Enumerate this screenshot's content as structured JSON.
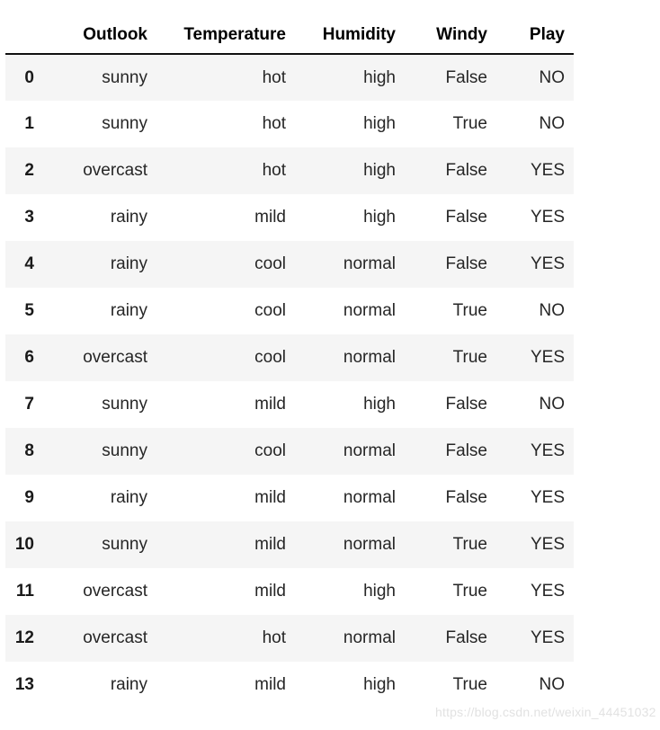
{
  "table": {
    "index_header": "",
    "columns": [
      "Outlook",
      "Temperature",
      "Humidity",
      "Windy",
      "Play"
    ],
    "rows": [
      {
        "index": "0",
        "cells": [
          "sunny",
          "hot",
          "high",
          "False",
          "NO"
        ]
      },
      {
        "index": "1",
        "cells": [
          "sunny",
          "hot",
          "high",
          "True",
          "NO"
        ]
      },
      {
        "index": "2",
        "cells": [
          "overcast",
          "hot",
          "high",
          "False",
          "YES"
        ]
      },
      {
        "index": "3",
        "cells": [
          "rainy",
          "mild",
          "high",
          "False",
          "YES"
        ]
      },
      {
        "index": "4",
        "cells": [
          "rainy",
          "cool",
          "normal",
          "False",
          "YES"
        ]
      },
      {
        "index": "5",
        "cells": [
          "rainy",
          "cool",
          "normal",
          "True",
          "NO"
        ]
      },
      {
        "index": "6",
        "cells": [
          "overcast",
          "cool",
          "normal",
          "True",
          "YES"
        ]
      },
      {
        "index": "7",
        "cells": [
          "sunny",
          "mild",
          "high",
          "False",
          "NO"
        ]
      },
      {
        "index": "8",
        "cells": [
          "sunny",
          "cool",
          "normal",
          "False",
          "YES"
        ]
      },
      {
        "index": "9",
        "cells": [
          "rainy",
          "mild",
          "normal",
          "False",
          "YES"
        ]
      },
      {
        "index": "10",
        "cells": [
          "sunny",
          "mild",
          "normal",
          "True",
          "YES"
        ]
      },
      {
        "index": "11",
        "cells": [
          "overcast",
          "mild",
          "high",
          "True",
          "YES"
        ]
      },
      {
        "index": "12",
        "cells": [
          "overcast",
          "hot",
          "normal",
          "False",
          "YES"
        ]
      },
      {
        "index": "13",
        "cells": [
          "rainy",
          "mild",
          "high",
          "True",
          "NO"
        ]
      }
    ]
  },
  "watermark": {
    "text": "https://blog.csdn.net/weixin_44451032"
  },
  "colors": {
    "page_background": "#ffffff",
    "stripe_row": "#f5f5f5",
    "header_text": "#000000",
    "body_text": "#262626",
    "header_rule": "#111111",
    "watermark_text": "#e2e2e2"
  }
}
